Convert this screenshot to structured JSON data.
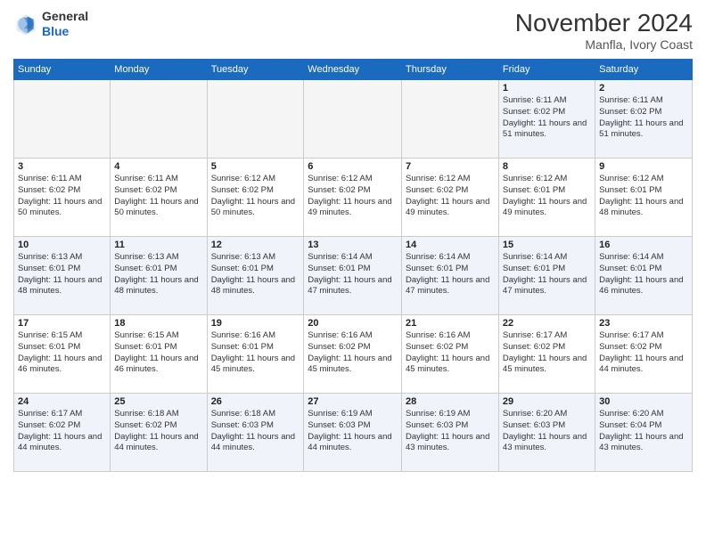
{
  "logo": {
    "line1": "General",
    "line2": "Blue"
  },
  "header": {
    "month": "November 2024",
    "location": "Manfla, Ivory Coast"
  },
  "weekdays": [
    "Sunday",
    "Monday",
    "Tuesday",
    "Wednesday",
    "Thursday",
    "Friday",
    "Saturday"
  ],
  "weeks": [
    [
      {
        "day": "",
        "info": ""
      },
      {
        "day": "",
        "info": ""
      },
      {
        "day": "",
        "info": ""
      },
      {
        "day": "",
        "info": ""
      },
      {
        "day": "",
        "info": ""
      },
      {
        "day": "1",
        "info": "Sunrise: 6:11 AM\nSunset: 6:02 PM\nDaylight: 11 hours and 51 minutes."
      },
      {
        "day": "2",
        "info": "Sunrise: 6:11 AM\nSunset: 6:02 PM\nDaylight: 11 hours and 51 minutes."
      }
    ],
    [
      {
        "day": "3",
        "info": "Sunrise: 6:11 AM\nSunset: 6:02 PM\nDaylight: 11 hours and 50 minutes."
      },
      {
        "day": "4",
        "info": "Sunrise: 6:11 AM\nSunset: 6:02 PM\nDaylight: 11 hours and 50 minutes."
      },
      {
        "day": "5",
        "info": "Sunrise: 6:12 AM\nSunset: 6:02 PM\nDaylight: 11 hours and 50 minutes."
      },
      {
        "day": "6",
        "info": "Sunrise: 6:12 AM\nSunset: 6:02 PM\nDaylight: 11 hours and 49 minutes."
      },
      {
        "day": "7",
        "info": "Sunrise: 6:12 AM\nSunset: 6:02 PM\nDaylight: 11 hours and 49 minutes."
      },
      {
        "day": "8",
        "info": "Sunrise: 6:12 AM\nSunset: 6:01 PM\nDaylight: 11 hours and 49 minutes."
      },
      {
        "day": "9",
        "info": "Sunrise: 6:12 AM\nSunset: 6:01 PM\nDaylight: 11 hours and 48 minutes."
      }
    ],
    [
      {
        "day": "10",
        "info": "Sunrise: 6:13 AM\nSunset: 6:01 PM\nDaylight: 11 hours and 48 minutes."
      },
      {
        "day": "11",
        "info": "Sunrise: 6:13 AM\nSunset: 6:01 PM\nDaylight: 11 hours and 48 minutes."
      },
      {
        "day": "12",
        "info": "Sunrise: 6:13 AM\nSunset: 6:01 PM\nDaylight: 11 hours and 48 minutes."
      },
      {
        "day": "13",
        "info": "Sunrise: 6:14 AM\nSunset: 6:01 PM\nDaylight: 11 hours and 47 minutes."
      },
      {
        "day": "14",
        "info": "Sunrise: 6:14 AM\nSunset: 6:01 PM\nDaylight: 11 hours and 47 minutes."
      },
      {
        "day": "15",
        "info": "Sunrise: 6:14 AM\nSunset: 6:01 PM\nDaylight: 11 hours and 47 minutes."
      },
      {
        "day": "16",
        "info": "Sunrise: 6:14 AM\nSunset: 6:01 PM\nDaylight: 11 hours and 46 minutes."
      }
    ],
    [
      {
        "day": "17",
        "info": "Sunrise: 6:15 AM\nSunset: 6:01 PM\nDaylight: 11 hours and 46 minutes."
      },
      {
        "day": "18",
        "info": "Sunrise: 6:15 AM\nSunset: 6:01 PM\nDaylight: 11 hours and 46 minutes."
      },
      {
        "day": "19",
        "info": "Sunrise: 6:16 AM\nSunset: 6:01 PM\nDaylight: 11 hours and 45 minutes."
      },
      {
        "day": "20",
        "info": "Sunrise: 6:16 AM\nSunset: 6:02 PM\nDaylight: 11 hours and 45 minutes."
      },
      {
        "day": "21",
        "info": "Sunrise: 6:16 AM\nSunset: 6:02 PM\nDaylight: 11 hours and 45 minutes."
      },
      {
        "day": "22",
        "info": "Sunrise: 6:17 AM\nSunset: 6:02 PM\nDaylight: 11 hours and 45 minutes."
      },
      {
        "day": "23",
        "info": "Sunrise: 6:17 AM\nSunset: 6:02 PM\nDaylight: 11 hours and 44 minutes."
      }
    ],
    [
      {
        "day": "24",
        "info": "Sunrise: 6:17 AM\nSunset: 6:02 PM\nDaylight: 11 hours and 44 minutes."
      },
      {
        "day": "25",
        "info": "Sunrise: 6:18 AM\nSunset: 6:02 PM\nDaylight: 11 hours and 44 minutes."
      },
      {
        "day": "26",
        "info": "Sunrise: 6:18 AM\nSunset: 6:03 PM\nDaylight: 11 hours and 44 minutes."
      },
      {
        "day": "27",
        "info": "Sunrise: 6:19 AM\nSunset: 6:03 PM\nDaylight: 11 hours and 44 minutes."
      },
      {
        "day": "28",
        "info": "Sunrise: 6:19 AM\nSunset: 6:03 PM\nDaylight: 11 hours and 43 minutes."
      },
      {
        "day": "29",
        "info": "Sunrise: 6:20 AM\nSunset: 6:03 PM\nDaylight: 11 hours and 43 minutes."
      },
      {
        "day": "30",
        "info": "Sunrise: 6:20 AM\nSunset: 6:04 PM\nDaylight: 11 hours and 43 minutes."
      }
    ]
  ]
}
